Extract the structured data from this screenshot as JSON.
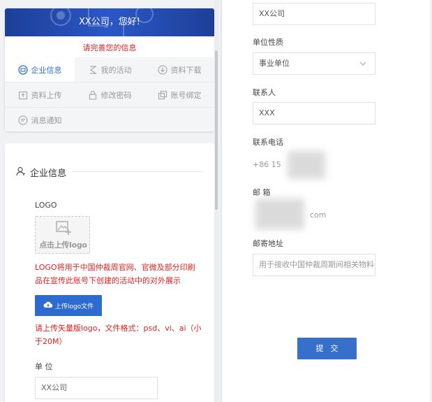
{
  "header": {
    "greeting": "XX公司，您好!",
    "notice": "请完善您的信息"
  },
  "menu": {
    "items": [
      {
        "label": "企业信息",
        "icon": "company-icon",
        "active": true
      },
      {
        "label": "我的活动",
        "icon": "activity-icon",
        "active": false
      },
      {
        "label": "资料下载",
        "icon": "download-icon",
        "active": false
      },
      {
        "label": "资料上传",
        "icon": "upload-icon",
        "active": false
      },
      {
        "label": "修改密码",
        "icon": "lock-icon",
        "active": false
      },
      {
        "label": "账号绑定",
        "icon": "link-icon",
        "active": false
      },
      {
        "label": "消息通知",
        "icon": "message-icon",
        "active": false
      }
    ]
  },
  "company_form": {
    "section_title": "企业信息",
    "logo_label": "LOGO",
    "logo_placeholder": "点击上传logo",
    "logo_description": "LOGO将用于中国仲裁周官网、官微及部分印刷品在宣传此账号下创建的活动中的对外展示",
    "upload_button": "上传logo文件",
    "upload_tip": "请上传矢量版logo，文件格式：psd、vi、ai（小于20M）",
    "unit_label": "单 位",
    "unit_value": "XX公司"
  },
  "right_form": {
    "unit_value": "XX公司",
    "nature_label": "单位性质",
    "nature_value": "事业单位",
    "contact_label": "联系人",
    "contact_value": "XXX",
    "phone_label": "联系电话",
    "phone_value": "+86 15",
    "email_label": "邮 箱",
    "email_value": "com",
    "address_label": "邮寄地址",
    "address_placeholder": "用于接收中国仲裁周期间相关物料",
    "submit_label": "提交"
  },
  "colors": {
    "accent": "#2d6bd0",
    "banner": "#2b57c6",
    "warning": "#e02020"
  }
}
